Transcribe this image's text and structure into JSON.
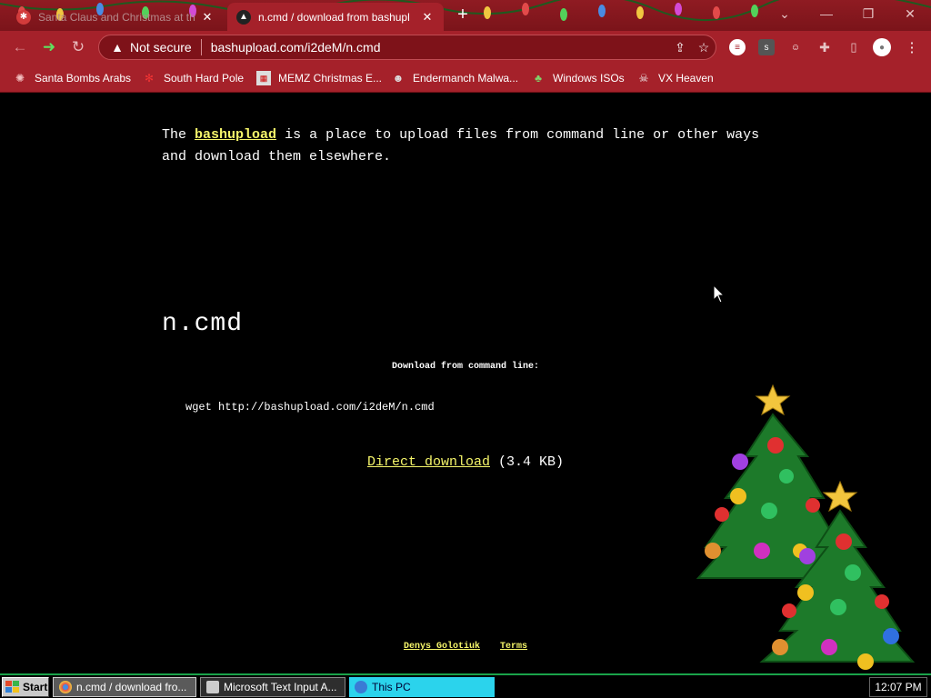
{
  "browser": {
    "tabs": [
      {
        "title": "Santa Claus and Christmas at th",
        "active": false
      },
      {
        "title": "n.cmd / download from bashupl",
        "active": true
      }
    ],
    "new_tab_icon": "plus-icon",
    "url_security": "Not secure",
    "url": "bashupload.com/i2deM/n.cmd"
  },
  "bookmarks": [
    {
      "label": "Santa Bombs Arabs",
      "icon": "santa-icon"
    },
    {
      "label": "South Hard Pole",
      "icon": "snowflake-icon"
    },
    {
      "label": "MEMZ Christmas E...",
      "icon": "page-icon"
    },
    {
      "label": "Endermanch Malwa...",
      "icon": "cat-icon"
    },
    {
      "label": "Windows ISOs",
      "icon": "tree-icon"
    },
    {
      "label": "VX Heaven",
      "icon": "skull-icon"
    }
  ],
  "page": {
    "intro_prefix": "The",
    "intro_link": "bashupload",
    "intro_rest": "is a place to upload files from command line or other ways and download them elsewhere.",
    "filename": "n.cmd",
    "download_label": "Download from command line:",
    "command": "wget http://bashupload.com/i2deM/n.cmd",
    "direct_link": "Direct download",
    "file_size": "(3.4 KB)",
    "footer_author": "Denys Golotiuk",
    "footer_terms": "Terms"
  },
  "taskbar": {
    "start": "Start",
    "tasks": [
      {
        "label": "n.cmd / download fro...",
        "icon": "chrome-icon"
      },
      {
        "label": "Microsoft Text Input A...",
        "icon": "window-icon"
      },
      {
        "label": "This PC",
        "icon": "pc-icon"
      }
    ],
    "clock": "12:07 PM"
  },
  "colors": {
    "browser_frame": "#a5212a",
    "link_yellow": "#f5f56a",
    "task_active": "#2bd3ec",
    "taskbar_border": "#1aa34a"
  }
}
